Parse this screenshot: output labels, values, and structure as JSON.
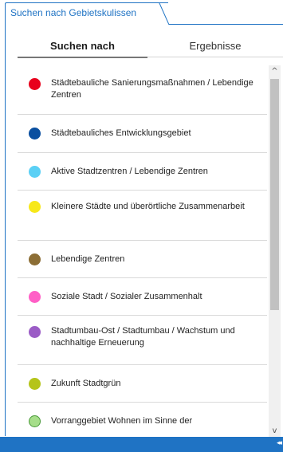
{
  "panel": {
    "title": "Suchen nach Gebietskulissen",
    "accent": "#1f73c4"
  },
  "tabs": {
    "search": "Suchen nach",
    "results": "Ergebnisse"
  },
  "items": [
    {
      "label": "Städtebauliche Sanierungsmaßnahmen / Lebendige Zentren",
      "color": "#e8001c"
    },
    {
      "label": "Städtebauliches Entwicklungsgebiet",
      "color": "#0a4fa0"
    },
    {
      "label": "Aktive Stadtzentren / Lebendige Zentren",
      "color": "#5bd0f5"
    },
    {
      "label": "Kleinere Städte und überörtliche Zusammenarbeit",
      "color": "#f7e81a"
    },
    {
      "label": "Lebendige Zentren",
      "color": "#8c6e35"
    },
    {
      "label": "Soziale Stadt / Sozialer Zusammenhalt",
      "color": "#ff5fc6"
    },
    {
      "label": "Stadtumbau-Ost / Stadtumbau / Wachstum und nachhaltige Erneuerung",
      "color": "#9b5cc6"
    },
    {
      "label": "Zukunft Stadtgrün",
      "color": "#b5c41a"
    },
    {
      "label": "Vorranggebiet Wohnen im Sinne der",
      "color": "#a6de8a"
    }
  ],
  "icons": {
    "scroll_up": "chevron-up-icon",
    "scroll_down": "chevron-down-icon",
    "collapse": "double-chevron-left-icon"
  }
}
